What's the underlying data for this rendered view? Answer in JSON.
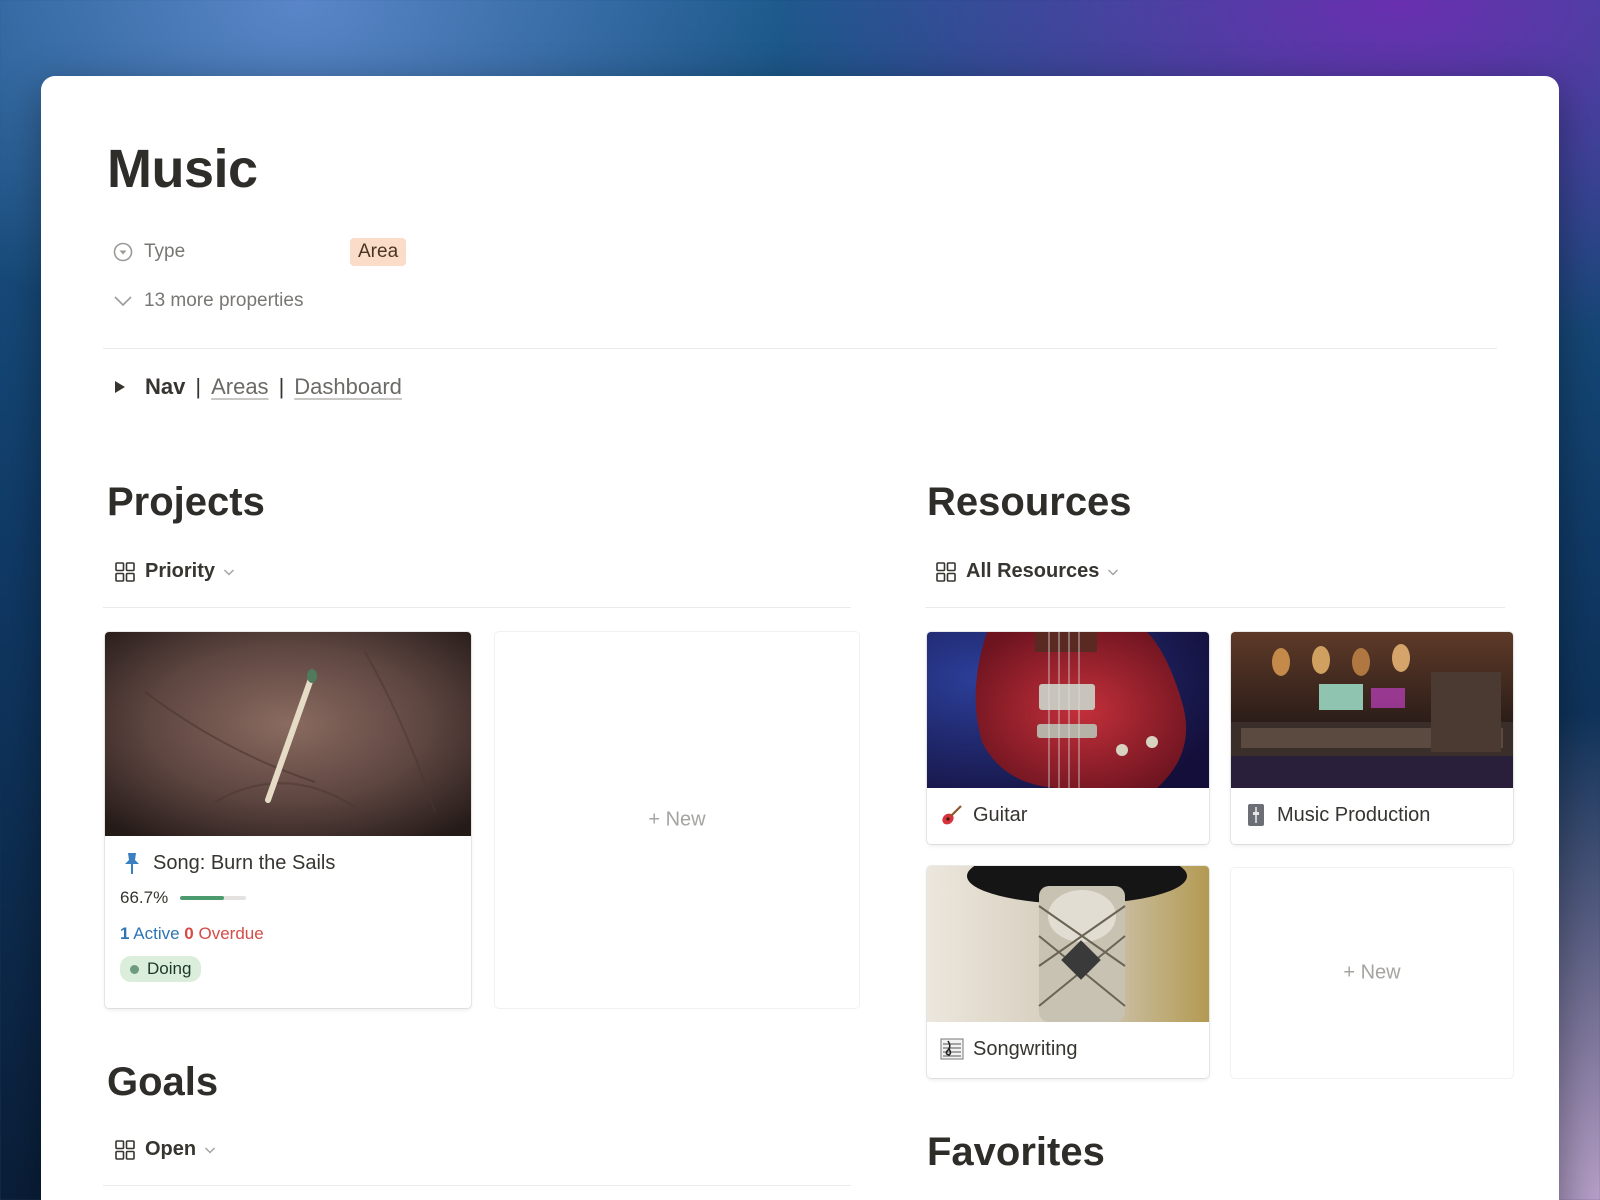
{
  "page": {
    "title": "Music",
    "properties": {
      "type_label": "Type",
      "type_value": "Area",
      "more_label": "13 more properties"
    },
    "nav": {
      "label": "Nav",
      "separator": "|",
      "links": [
        "Areas",
        "Dashboard"
      ]
    }
  },
  "projects": {
    "title": "Projects",
    "view": "Priority",
    "cards": [
      {
        "title": "Song: Burn the Sails",
        "icon": "pushpin-icon",
        "progress_text": "66.7%",
        "progress": 0.667,
        "active_count": "1",
        "active_label": "Active",
        "overdue_count": "0",
        "overdue_label": "Overdue",
        "status": "Doing"
      }
    ],
    "new_label": "New"
  },
  "resources": {
    "title": "Resources",
    "view": "All Resources",
    "cards": [
      {
        "title": "Guitar",
        "icon": "guitar-icon"
      },
      {
        "title": "Music Production",
        "icon": "control-knobs-icon"
      },
      {
        "title": "Songwriting",
        "icon": "musical-score-icon"
      }
    ],
    "new_label": "New"
  },
  "goals": {
    "title": "Goals",
    "view": "Open"
  },
  "favorites": {
    "title": "Favorites"
  },
  "colors": {
    "accent_green": "#4b9b6f",
    "active_blue": "#2e74b5",
    "overdue_red": "#d44c47",
    "area_tag_bg": "#fbdcc8",
    "doing_pill_bg": "#dbeddb"
  }
}
